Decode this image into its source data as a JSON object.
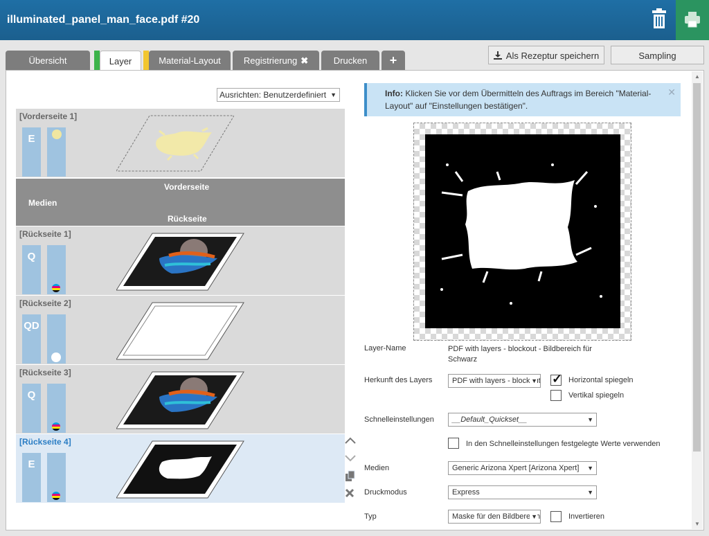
{
  "header": {
    "title": "illuminated_panel_man_face.pdf #20"
  },
  "tabs": [
    {
      "label": "Übersicht",
      "active": false
    },
    {
      "label": "Layer",
      "active": true,
      "color": "#3cb44b"
    },
    {
      "label": "Material-Layout",
      "active": false,
      "color": "#f2c62f"
    },
    {
      "label": "Registrierung",
      "active": false
    },
    {
      "label": "Drucken",
      "active": false
    },
    {
      "label": "+",
      "active": false
    }
  ],
  "toolbar": {
    "save_recipe": "Als Rezeptur speichern",
    "sampling": "Sampling"
  },
  "left": {
    "align_select": "Ausrichten: Benutzerdefiniert",
    "media_block": {
      "front": "Vorderseite",
      "media": "Medien",
      "back": "Rückseite"
    },
    "layers": [
      {
        "label": "[Vorderseite 1]",
        "code": "E"
      },
      {
        "label": "[Rückseite 1]",
        "code": "Q"
      },
      {
        "label": "[Rückseite 2]",
        "code": "QD"
      },
      {
        "label": "[Rückseite 3]",
        "code": "Q"
      },
      {
        "label": "[Rückseite 4]",
        "code": "E",
        "selected": true
      }
    ]
  },
  "info": {
    "bold": "Info:",
    "text": " Klicken Sie vor dem Übermitteln des Auftrags im Bereich \"Material-Layout\" auf \"Einstellungen bestätigen\"."
  },
  "form": {
    "layer_name_label": "Layer-Name",
    "layer_name_value": "PDF with layers - blockout - Bildbereich für Schwarz",
    "origin_label": "Herkunft des Layers",
    "origin_value": "PDF with layers - blockout",
    "mirror_h": "Horizontal spiegeln",
    "mirror_h_checked": true,
    "mirror_v": "Vertikal spiegeln",
    "mirror_v_checked": false,
    "quick_label": "Schnelleinstellungen",
    "quick_value": "__Default_Quickset__",
    "use_quick": "In den Schnelleinstellungen festgelegte Werte verwenden",
    "media_label": "Medien",
    "media_value": "Generic Arizona Xpert [Arizona Xpert]",
    "mode_label": "Druckmodus",
    "mode_value": "Express",
    "type_label": "Typ",
    "type_value": "Maske für den Bildbereich",
    "invert": "Invertieren"
  },
  "colors": {
    "header": "#1f6fa5",
    "print": "#2b9460",
    "accent": "#3d8ec9"
  }
}
